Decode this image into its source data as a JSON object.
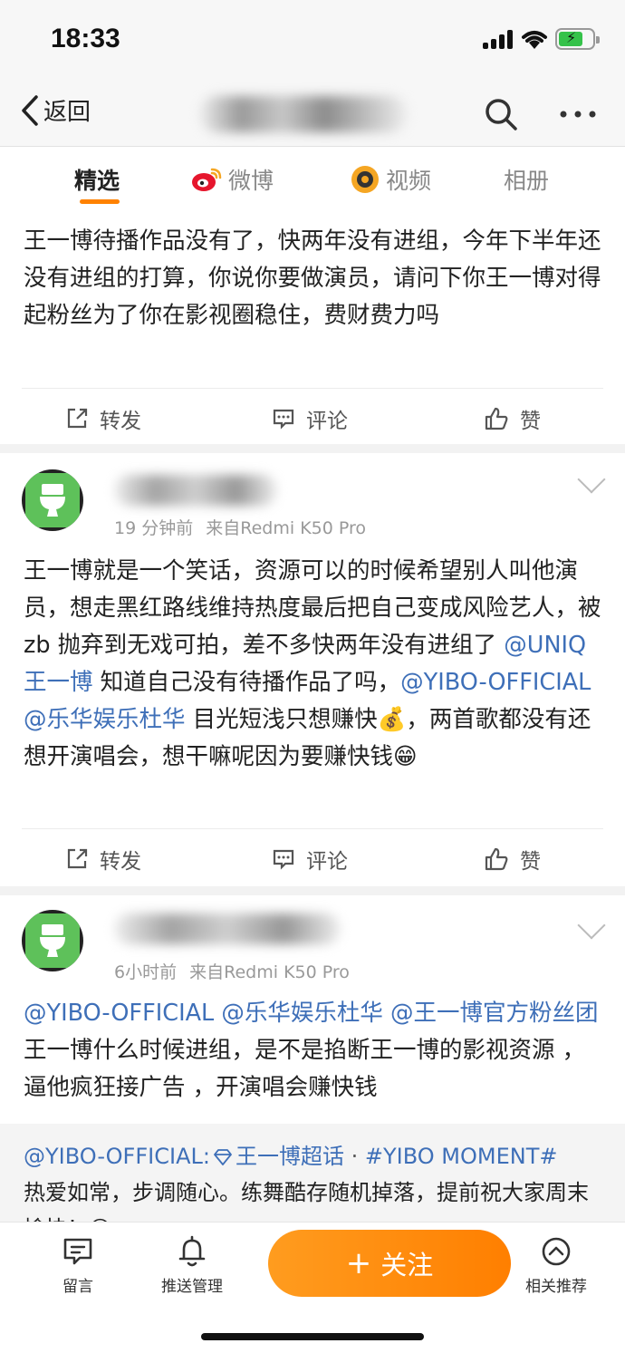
{
  "status_bar": {
    "time": "18:33"
  },
  "nav": {
    "back_label": "返回"
  },
  "tabs": [
    {
      "label": "精选"
    },
    {
      "label": "微博"
    },
    {
      "label": "视频"
    },
    {
      "label": "相册"
    }
  ],
  "posts": [
    {
      "text": "王一博待播作品没有了，快两年没有进组，今年下半年还没有进组的打算，你说你要做演员，请问下你王一博对得起粉丝为了你在影视圈稳住，费财费力吗",
      "actions": {
        "repost": "转发",
        "comment": "评论",
        "like": "赞"
      }
    },
    {
      "time": "19 分钟前",
      "source": "来自Redmi K50 Pro",
      "text_parts": {
        "p1": "王一博就是一个笑话，资源可以的时候希望别人叫他演员，想走黑红路线维持热度最后把自己变成风险艺人，被 zb 抛弃到无戏可拍，差不多快两年没有进组了 ",
        "m1": "@UNIQ王一博",
        "p2": " 知道自己没有待播作品了吗，",
        "m2": "@YIBO-OFFICIAL",
        "p3": " ",
        "m3": "@乐华娱乐杜华",
        "p4": " 目光短浅只想赚快",
        "e1": "💰",
        "p5": "，两首歌都没有还想开演唱会，想干嘛呢因为要赚快钱",
        "e2": "😁"
      },
      "actions": {
        "repost": "转发",
        "comment": "评论",
        "like": "赞"
      }
    },
    {
      "time": "6小时前",
      "source": "来自Redmi K50 Pro",
      "text_parts": {
        "m1": "@YIBO-OFFICIAL",
        "p1": " ",
        "m2": "@乐华娱乐杜华",
        "p2": " ",
        "m3": "@王一博官方粉丝团",
        "p3": " 王一博什么时候进组，是不是掐断王一博的影视资源 ，逼他疯狂接广告 ，开演唱会赚快钱"
      },
      "repost": {
        "author": "@YIBO-OFFICIAL:",
        "topic": "王一博超话",
        "sep": " · ",
        "hashtag": "#YIBO MOMENT#",
        "text": "热爱如常，步调随心。练舞酷存随机掉落，提前祝大家周末愉快！",
        "emoji": "😊"
      }
    }
  ],
  "bottom_bar": {
    "message": "留言",
    "push_manage": "推送管理",
    "follow": "关注",
    "follow_plus": "+",
    "related": "相关推荐"
  },
  "colors": {
    "accent": "#ff8200",
    "link": "#3e6fb8"
  }
}
